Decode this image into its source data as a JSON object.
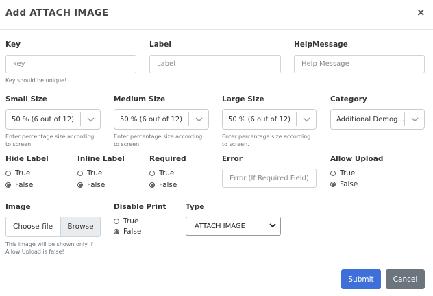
{
  "dialog": {
    "title": "Add ATTACH IMAGE",
    "close_label": "×"
  },
  "fields": {
    "key": {
      "label": "Key",
      "placeholder": "key",
      "hint": "Key should be unique!"
    },
    "label": {
      "label": "Label",
      "placeholder": "Label"
    },
    "help": {
      "label": "HelpMessage",
      "placeholder": "Help Message"
    },
    "small_size": {
      "label": "Small Size",
      "value": "50 % (6 out of 12)",
      "hint": [
        "Enter percentage size according",
        "to screen."
      ]
    },
    "medium_size": {
      "label": "Medium Size",
      "value": "50 % (6 out of 12)",
      "hint": [
        "Enter percentage size according",
        "to screen."
      ]
    },
    "large_size": {
      "label": "Large Size",
      "value": "50 % (6 out of 12)",
      "hint": [
        "Enter percentage size according",
        "to screen."
      ]
    },
    "category": {
      "label": "Category",
      "value": "Additional Demog..."
    },
    "hide_label": {
      "label": "Hide Label",
      "options": [
        "True",
        "False"
      ],
      "selected": "False"
    },
    "inline_label": {
      "label": "Inline Label",
      "options": [
        "True",
        "False"
      ],
      "selected": "False"
    },
    "required": {
      "label": "Required",
      "options": [
        "True",
        "False"
      ],
      "selected": "False"
    },
    "error": {
      "label": "Error",
      "placeholder": "Error (If Required Field)"
    },
    "allow_upload": {
      "label": "Allow Upload",
      "options": [
        "True",
        "False"
      ],
      "selected": "False"
    },
    "image": {
      "label": "Image",
      "choose_label": "Choose file",
      "browse_label": "Browse",
      "hint": [
        "This image will be shown only if",
        "Allow Upload is false!"
      ]
    },
    "disable_print": {
      "label": "Disable Print",
      "options": [
        "True",
        "False"
      ],
      "selected": "False"
    },
    "type": {
      "label": "Type",
      "value": "ATTACH IMAGE"
    }
  },
  "footer": {
    "submit_label": "Submit",
    "cancel_label": "Cancel"
  },
  "colors": {
    "primary": "#3f6fd8",
    "secondary": "#6c757d",
    "border": "#ced4da",
    "hint": "#6c757d"
  },
  "icons": {
    "close": "close-icon",
    "dropdown": "chevron-down-icon",
    "radio": "radio-icon"
  }
}
